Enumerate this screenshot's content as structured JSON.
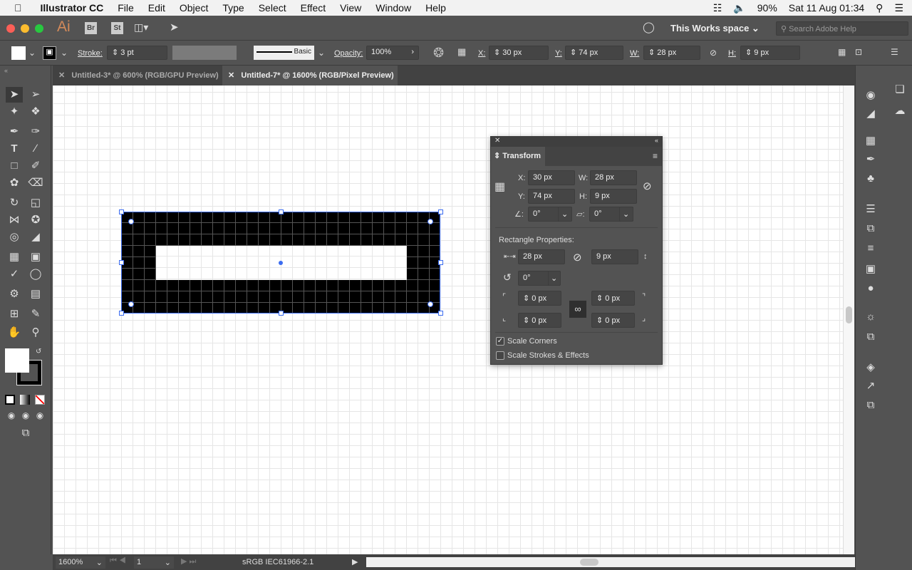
{
  "menubar": {
    "app": "Illustrator CC",
    "items": [
      "File",
      "Edit",
      "Object",
      "Type",
      "Select",
      "Effect",
      "View",
      "Window",
      "Help"
    ],
    "battery": "90%",
    "clock": "Sat 11 Aug  01:34"
  },
  "appbar": {
    "logo": "Ai",
    "bridge": "Br",
    "stock": "St",
    "workspace": "This Works space",
    "search_placeholder": "Search Adobe Help"
  },
  "control": {
    "stroke_label": "Stroke:",
    "stroke_value": "3 pt",
    "brush": "Basic",
    "opacity_label": "Opacity:",
    "opacity_value": "100%",
    "x_label": "X:",
    "x": "30 px",
    "y_label": "Y:",
    "y": "74 px",
    "w_label": "W:",
    "w": "28 px",
    "h_label": "H:",
    "h": "9 px"
  },
  "tabs": [
    {
      "label": "Untitled-3* @ 600% (RGB/GPU Preview)",
      "active": false
    },
    {
      "label": "Untitled-7* @ 1600% (RGB/Pixel Preview)",
      "active": true
    }
  ],
  "status": {
    "zoom": "1600%",
    "artboard": "1",
    "profile": "sRGB IEC61966-2.1"
  },
  "transform": {
    "title": "Transform",
    "x_label": "X:",
    "x": "30 px",
    "y_label": "Y:",
    "y": "74 px",
    "w_label": "W:",
    "w": "28 px",
    "h_label": "H:",
    "h": "9 px",
    "angle": "0°",
    "shear": "0°",
    "rect_title": "Rectangle Properties:",
    "rect_w": "28 px",
    "rect_h": "9 px",
    "rect_angle": "0°",
    "corners": [
      "0 px",
      "0 px",
      "0 px",
      "0 px"
    ],
    "scale_corners": "Scale Corners",
    "scale_corners_checked": true,
    "scale_strokes": "Scale Strokes & Effects",
    "scale_strokes_checked": false
  },
  "colors": {
    "selection": "#3b6cf0",
    "ui": "#535353"
  }
}
